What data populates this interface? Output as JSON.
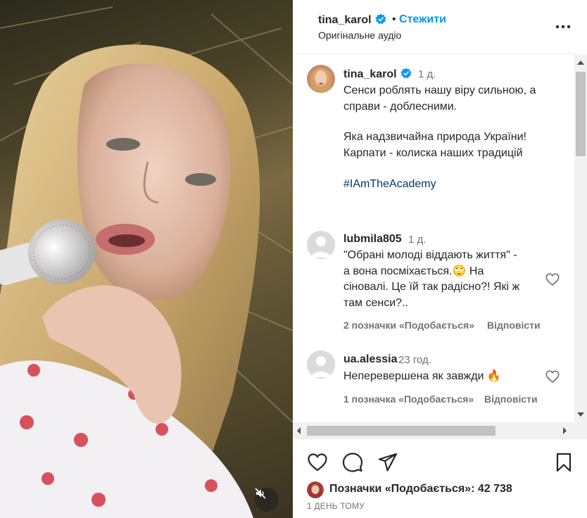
{
  "header": {
    "username": "tina_karol",
    "separator": "•",
    "follow_label": "Стежити",
    "audio_label": "Оригінальне аудіо",
    "more_icon": "more-horizontal-icon"
  },
  "caption": {
    "username": "tina_karol",
    "time": "1 д.",
    "lines": [
      "Сенси роблять нашу віру сильною, а",
      "справи - доблесними.",
      "Яка надзвичайна природа України!",
      "Карпати - колиска наших традицій"
    ],
    "hashtag": "#IAmTheAcademy"
  },
  "comments": [
    {
      "username": "lubmila805",
      "time": "1 д.",
      "lines": [
        "\"Обрані молоді віддають життя\" -",
        "а вона посміхається.🙄  На",
        "сіновалі. Це їй так радісно?! Які ж",
        "там сенси?.."
      ],
      "likes_label": "2 позначки «Подобається»",
      "reply_label": "Відповісти"
    },
    {
      "username": "ua.alessia",
      "time": "23 год.",
      "lines": [
        "Неперевершена як завжди 🔥"
      ],
      "likes_label": "1 позначка «Подобається»",
      "reply_label": "Відповісти"
    }
  ],
  "actions": {
    "icons": [
      "heart-icon",
      "comment-icon",
      "share-icon",
      "bookmark-icon"
    ],
    "likes_label": "Позначки «Подобається»: 42 738",
    "date": "1 ДЕНЬ ТОМУ"
  },
  "colors": {
    "link_blue": "#0095f6",
    "verified_blue": "#0095f6",
    "hashtag": "#00376b",
    "secondary_text": "#737373"
  }
}
